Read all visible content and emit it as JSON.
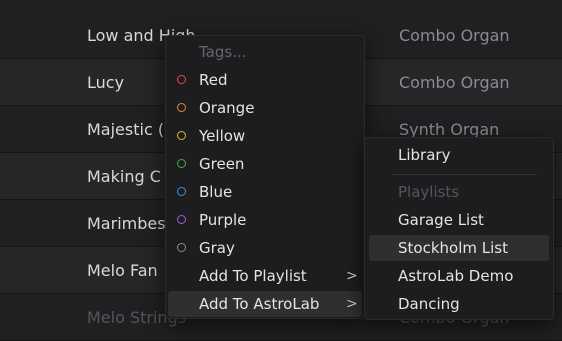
{
  "rows": [
    {
      "name": "Low and High",
      "category": "Combo Organ",
      "extra": ""
    },
    {
      "name": "Lucy",
      "category": "Combo Organ",
      "extra": ""
    },
    {
      "name": "Majestic (",
      "category": "Synth Organ",
      "extra": ")"
    },
    {
      "name": "Making C",
      "category": "",
      "extra": ""
    },
    {
      "name": "Marimbes",
      "category": "",
      "extra": ""
    },
    {
      "name": "Melo Fan",
      "category": "",
      "extra": ""
    },
    {
      "name": "Melo Strings",
      "category": "Combo Organ",
      "extra": ""
    }
  ],
  "context_menu": {
    "header": "Tags...",
    "tags": [
      {
        "label": "Red",
        "color": "#e5484d"
      },
      {
        "label": "Orange",
        "color": "#e8862f"
      },
      {
        "label": "Yellow",
        "color": "#e3b81f"
      },
      {
        "label": "Green",
        "color": "#3fae46"
      },
      {
        "label": "Blue",
        "color": "#3f8fd6"
      },
      {
        "label": "Purple",
        "color": "#9a5fd6"
      },
      {
        "label": "Gray",
        "color": "#8c8c90"
      }
    ],
    "add_to_playlist": "Add To Playlist",
    "add_to_astrolab": "Add To AstroLab",
    "arrow": ">"
  },
  "submenu": {
    "library": "Library",
    "playlists_header": "Playlists",
    "playlists": [
      "Garage List",
      "Stockholm List",
      "AstroLab Demo",
      "Dancing"
    ],
    "highlighted": "Stockholm List"
  }
}
